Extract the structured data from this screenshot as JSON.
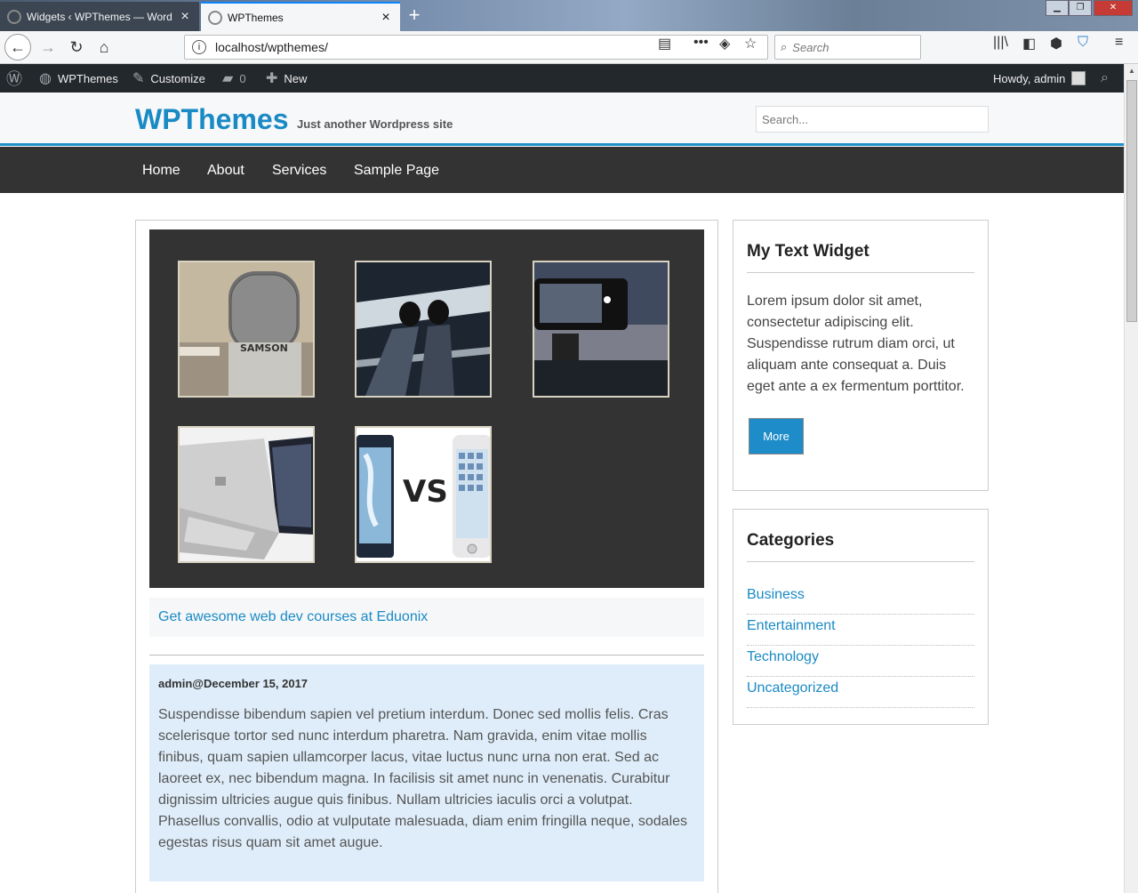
{
  "browser": {
    "tabs": [
      {
        "label": "Widgets ‹ WPThemes — WordPress",
        "active": false
      },
      {
        "label": "WPThemes",
        "active": true
      }
    ],
    "new_tab": "+",
    "url": "localhost/wpthemes/",
    "search_placeholder": "Search"
  },
  "adminbar": {
    "site_name": "WPThemes",
    "customize": "Customize",
    "comments_count": "0",
    "new": "New",
    "howdy": "Howdy, admin"
  },
  "site": {
    "title": "WPThemes",
    "tagline": "Just another Wordpress site",
    "search_placeholder": "Search..."
  },
  "nav": {
    "items": [
      "Home",
      "About",
      "Services",
      "Sample Page"
    ]
  },
  "gallery": {
    "images": [
      "microphone",
      "feet on railing",
      "phone photo at dusk",
      "laptop",
      "phone vs phone"
    ],
    "vs_text": "VS"
  },
  "post": {
    "link_text": "Get awesome web dev courses at Eduonix",
    "meta": "admin@December 15, 2017",
    "body": "Suspendisse bibendum sapien vel pretium interdum. Donec sed mollis felis. Cras scelerisque tortor sed nunc interdum pharetra. Nam gravida, enim vitae mollis finibus, quam sapien ullamcorper lacus, vitae luctus nunc urna non erat. Sed ac laoreet ex, nec bibendum magna. In facilisis sit amet nunc in venenatis. Curabitur dignissim ultricies augue quis finibus. Nullam ultricies iaculis orci a volutpat. Phasellus convallis, odio at vulputate malesuada, diam enim fringilla neque, sodales egestas risus quam sit amet augue."
  },
  "sidebar": {
    "text_widget": {
      "title": "My Text Widget",
      "text": "Lorem ipsum dolor sit amet, consectetur adipiscing elit. Suspendisse rutrum diam orci, ut aliquam ante consequat a. Duis eget ante a ex fermentum porttitor.",
      "button": "More"
    },
    "categories": {
      "title": "Categories",
      "items": [
        "Business",
        "Entertainment",
        "Technology",
        "Uncategorized"
      ]
    }
  },
  "colors": {
    "accent": "#1a8ac4",
    "adminbar": "#23282d",
    "nav": "#333333",
    "post_bg": "#deedf9"
  }
}
